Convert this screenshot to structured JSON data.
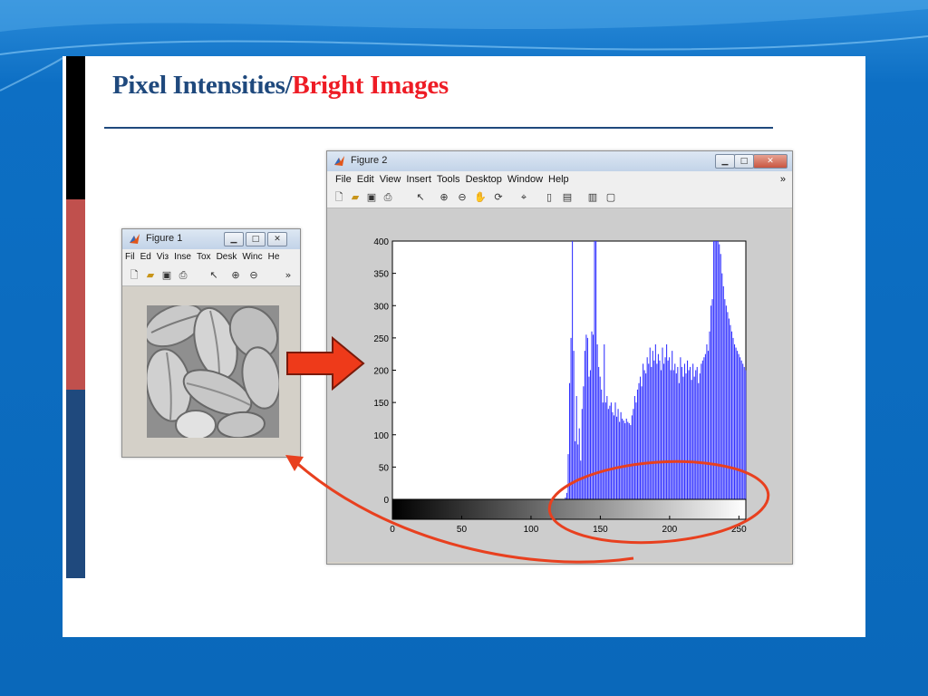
{
  "slide": {
    "title_part1": "Pixel Intensities/",
    "title_part2": "Bright Images"
  },
  "figure1": {
    "title": "Figure 1",
    "menu": [
      "Fil",
      "Ed",
      "Viз",
      "Insе",
      "Tox",
      "Desk",
      "Winc",
      "He"
    ],
    "overflow": "»"
  },
  "figure2": {
    "title": "Figure 2",
    "menu": [
      "File",
      "Edit",
      "View",
      "Insert",
      "Tools",
      "Desktop",
      "Window",
      "Help"
    ],
    "overflow": "»"
  },
  "icons": {
    "toolbar": [
      "new-file-icon",
      "open-folder-icon",
      "save-icon",
      "print-icon",
      "pointer-icon",
      "zoom-in-icon",
      "zoom-out-icon",
      "pan-hand-icon",
      "rotate-3d-icon",
      "data-cursor-icon",
      "colorbar-icon",
      "legend-icon",
      "hide-plot-tools-icon",
      "show-plot-tools-icon"
    ]
  },
  "colors": {
    "histogram": "#3333ff",
    "highlight": "#e8401f",
    "title_red": "#ee1c25",
    "title_blue": "#1f497d"
  },
  "chart_data": {
    "type": "bar",
    "title": "",
    "xlabel": "",
    "ylabel": "",
    "xlim": [
      0,
      255
    ],
    "ylim": [
      0,
      400
    ],
    "xticks": [
      0,
      50,
      100,
      150,
      200,
      250
    ],
    "yticks": [
      0,
      50,
      100,
      150,
      200,
      250,
      300,
      350,
      400
    ],
    "colorbar": "grayscale 0-255",
    "x": [
      125,
      126,
      127,
      128,
      129,
      130,
      131,
      132,
      133,
      134,
      135,
      136,
      137,
      138,
      139,
      140,
      141,
      142,
      143,
      144,
      145,
      146,
      147,
      148,
      149,
      150,
      151,
      152,
      153,
      154,
      155,
      156,
      157,
      158,
      159,
      160,
      161,
      162,
      163,
      164,
      165,
      166,
      167,
      168,
      169,
      170,
      171,
      172,
      173,
      174,
      175,
      176,
      177,
      178,
      179,
      180,
      181,
      182,
      183,
      184,
      185,
      186,
      187,
      188,
      189,
      190,
      191,
      192,
      193,
      194,
      195,
      196,
      197,
      198,
      199,
      200,
      201,
      202,
      203,
      204,
      205,
      206,
      207,
      208,
      209,
      210,
      211,
      212,
      213,
      214,
      215,
      216,
      217,
      218,
      219,
      220,
      221,
      222,
      223,
      224,
      225,
      226,
      227,
      228,
      229,
      230,
      231,
      232,
      233,
      234,
      235,
      236,
      237,
      238,
      239,
      240,
      241,
      242,
      243,
      244,
      245,
      246,
      247,
      248,
      249,
      250,
      251,
      252,
      253,
      254,
      255
    ],
    "values": [
      3,
      10,
      70,
      180,
      250,
      400,
      230,
      90,
      160,
      85,
      110,
      60,
      140,
      175,
      230,
      255,
      250,
      190,
      200,
      260,
      255,
      400,
      410,
      240,
      205,
      190,
      170,
      150,
      240,
      150,
      160,
      140,
      145,
      150,
      135,
      130,
      150,
      128,
      140,
      120,
      135,
      125,
      122,
      118,
      125,
      120,
      118,
      115,
      130,
      140,
      160,
      150,
      170,
      180,
      190,
      175,
      210,
      200,
      195,
      220,
      210,
      235,
      205,
      230,
      215,
      240,
      210,
      225,
      215,
      200,
      235,
      210,
      220,
      240,
      215,
      220,
      200,
      230,
      200,
      210,
      195,
      205,
      180,
      220,
      205,
      190,
      210,
      195,
      215,
      200,
      205,
      185,
      210,
      190,
      200,
      205,
      180,
      195,
      210,
      215,
      220,
      225,
      240,
      230,
      260,
      300,
      310,
      400,
      420,
      415,
      400,
      395,
      380,
      350,
      330,
      310,
      300,
      290,
      280,
      270,
      260,
      250,
      240,
      235,
      230,
      225,
      220,
      215,
      210,
      205,
      200
    ]
  }
}
